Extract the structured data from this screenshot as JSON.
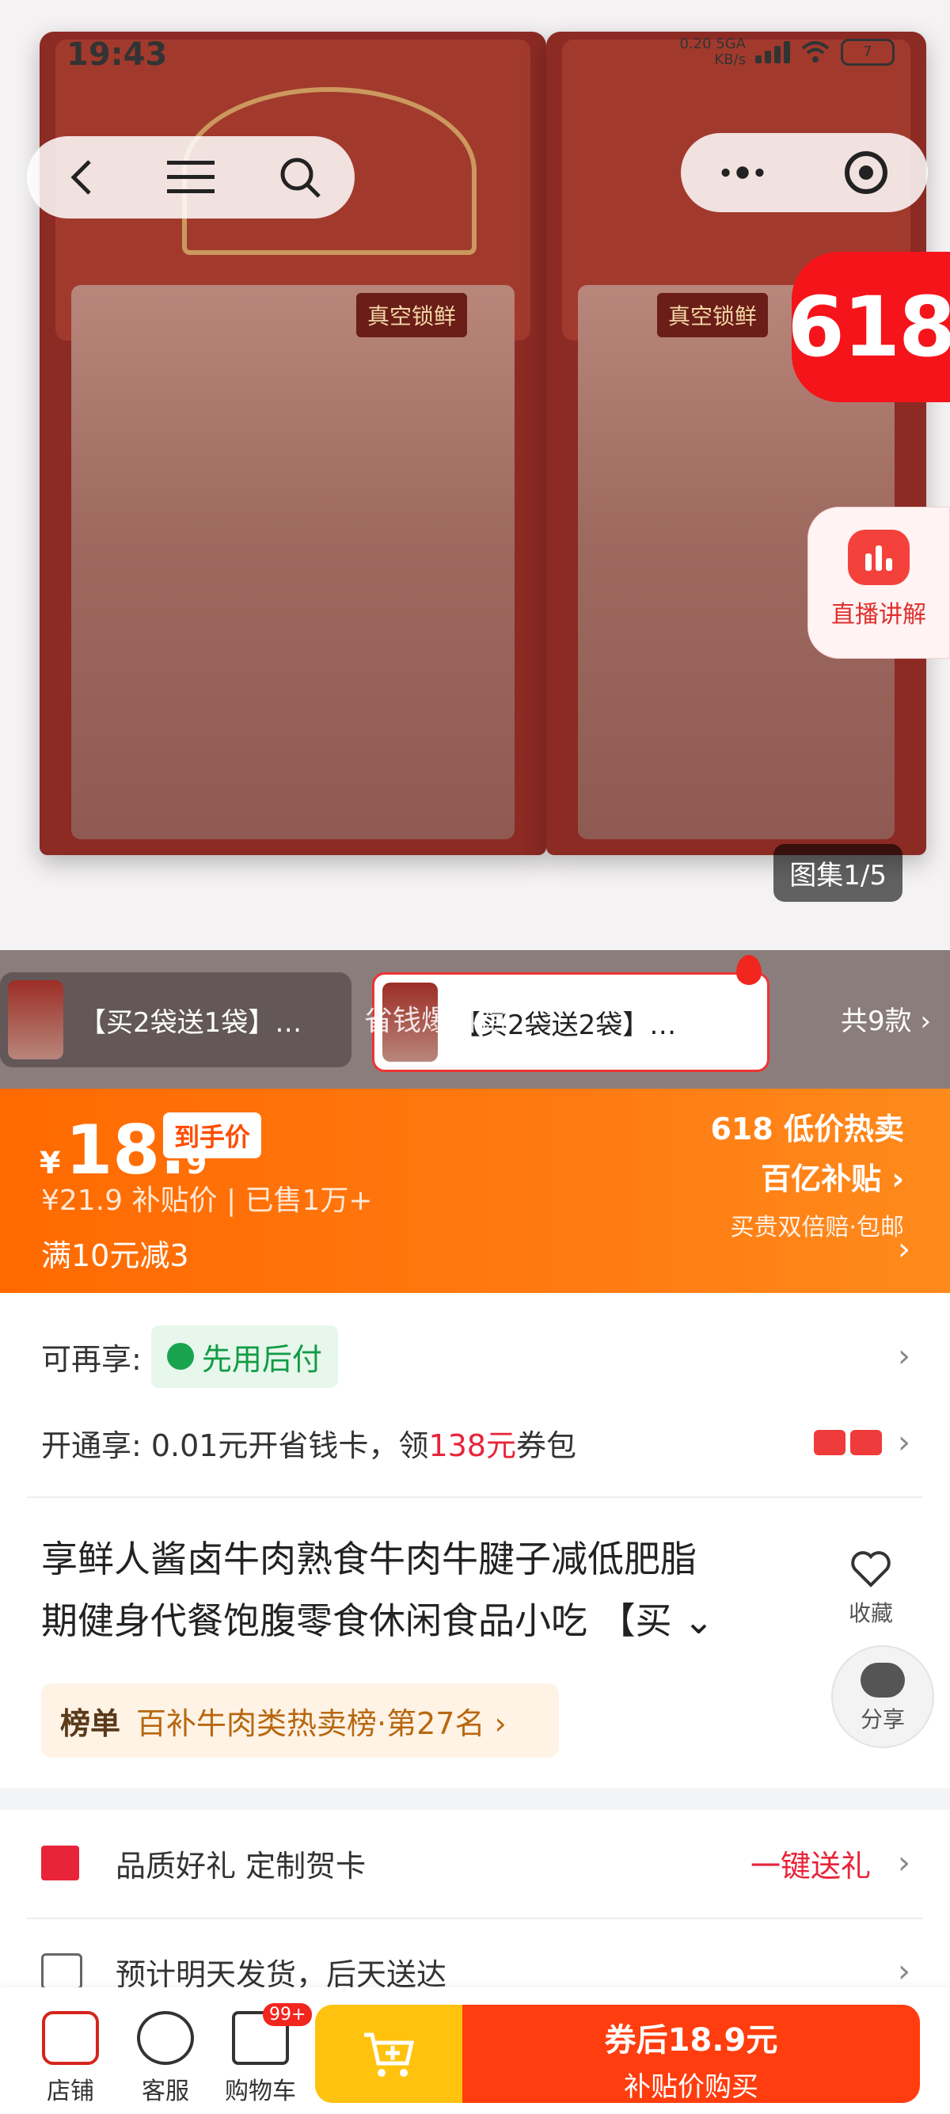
{
  "status_bar": {
    "time": "19:43",
    "network_speed": "0.20",
    "network_unit": "KB/s",
    "network_type": "5GA",
    "battery": "7"
  },
  "hero": {
    "bag_tag": "真空锁鲜",
    "badge": "618",
    "live_label": "直播讲解",
    "gallery_counter": "图集1/5"
  },
  "sku": {
    "option1": "【买2袋送1袋】…",
    "option2": "【买2袋送2袋】…",
    "overlay_text": "省钱爆料馆",
    "count": "共9款 ›"
  },
  "price": {
    "currency": "¥",
    "integer": "18.",
    "decimal": "9",
    "tag": "到手价",
    "sub": "¥21.9 补贴价 | 已售1万+",
    "promo": "满10元减3",
    "hot_title": "618 低价热卖",
    "hot_subsidy": "百亿补贴 ›",
    "hot_desc": "买贵双倍赔·包邮"
  },
  "services": {
    "pay_label": "可再享:",
    "pay_tag": "先用后付",
    "card_label": "开通享:",
    "card_text_a": "0.01元开省钱卡，领",
    "card_amount": "138元",
    "card_text_b": "券包"
  },
  "product": {
    "title_line1": "享鲜人酱卤牛肉熟食牛肉牛腱子减低肥脂",
    "title_line2": "期健身代餐饱腹零食休闲食品小吃 【买",
    "favorite": "收藏",
    "share": "分享",
    "rank_label": "榜单",
    "rank_text": "百补牛肉类热卖榜·第27名 ›"
  },
  "gift": {
    "text": "品质好礼 定制贺卡",
    "action": "一键送礼"
  },
  "shipping": {
    "text": "预计明天发货，后天送达"
  },
  "bottom_bar": {
    "store": "店铺",
    "service": "客服",
    "cart": "购物车",
    "cart_badge": "99+",
    "buy_line1": "券后18.9元",
    "buy_line2": "补贴价购买"
  },
  "colors": {
    "accent": "#ff6a00",
    "buy": "#ff3d0f",
    "add_cart": "#ffc20e",
    "badge": "#f5141a"
  }
}
